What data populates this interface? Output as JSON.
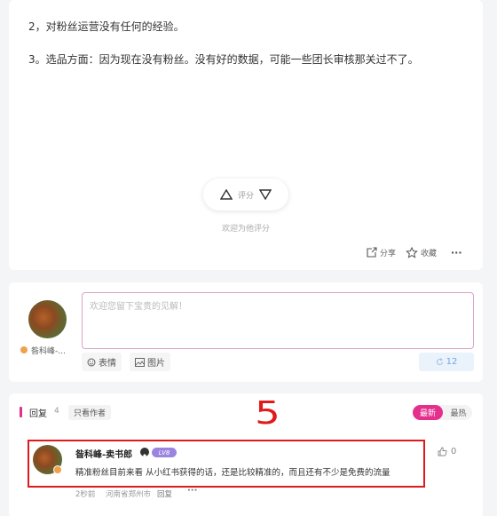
{
  "answer": {
    "para2": "2，对粉丝运营没有任何的经验。",
    "para3": "3。选品方面：因为现在没有粉丝。没有好的数据，可能一些团长审核那关过不了。",
    "vote_label": "评分",
    "vote_hint": "欢迎为他评分",
    "share_label": "分享",
    "collect_label": "收藏",
    "more_label": "···"
  },
  "comment_box": {
    "username": "昝科峰-...",
    "placeholder": "欢迎您留下宝贵的见解！",
    "emoji_label": "表情",
    "image_label": "图片",
    "submit_count": "12"
  },
  "replies": {
    "title": "回复",
    "count": "4",
    "author_only_label": "只看作者",
    "annotation": "5",
    "sort_latest": "最新",
    "sort_hot": "最热",
    "items": [
      {
        "author": "昝科峰-卖书郎",
        "level": "LV8",
        "content": "精准粉丝目前来看 从小红书获得的话，还是比较精准的，而且还有不少是免费的流量",
        "time": "2秒前",
        "location": "河南省郑州市",
        "reply_label": "回复",
        "more_label": "···",
        "likes": "0"
      }
    ]
  },
  "colors": {
    "accent": "#e4308c",
    "highlight_box": "#e01a1a",
    "level_badge": "#9b83e0"
  }
}
